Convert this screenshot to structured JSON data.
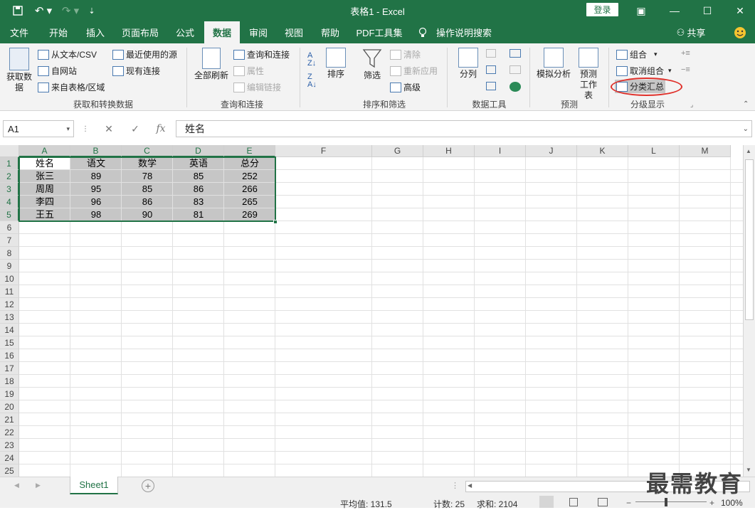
{
  "app": {
    "title": "表格1  -  Excel",
    "login": "登录"
  },
  "menu_tabs": [
    "文件",
    "开始",
    "插入",
    "页面布局",
    "公式",
    "数据",
    "审阅",
    "视图",
    "帮助",
    "PDF工具集",
    "操作说明搜索"
  ],
  "menu_active": "数据",
  "share": "共享",
  "ribbon": {
    "get_data": "获取数据",
    "from_text_csv": "从文本/CSV",
    "from_web": "自网站",
    "from_table": "来自表格/区域",
    "recent_sources": "最近使用的源",
    "existing_connections": "现有连接",
    "group_get_transform": "获取和转换数据",
    "refresh_all": "全部刷新",
    "queries_connections": "查询和连接",
    "properties": "属性",
    "edit_links": "编辑链接",
    "group_queries": "查询和连接",
    "sort": "排序",
    "filter": "筛选",
    "clear": "清除",
    "reapply": "重新应用",
    "advanced": "高级",
    "group_sort_filter": "排序和筛选",
    "text_to_columns": "分列",
    "group_data_tools": "数据工具",
    "what_if": "模拟分析",
    "forecast_sheet": "预测工作表",
    "group_forecast": "预测",
    "group_btn": "组合",
    "ungroup_btn": "取消组合",
    "subtotal_btn": "分类汇总",
    "group_outline": "分级显示"
  },
  "formula_bar": {
    "name_box": "A1",
    "fx": "fx",
    "content": "姓名"
  },
  "columns": [
    "A",
    "B",
    "C",
    "D",
    "E",
    "F",
    "G",
    "H",
    "I",
    "J",
    "K",
    "L",
    "M"
  ],
  "rows": [
    "1",
    "2",
    "3",
    "4",
    "5",
    "6",
    "7",
    "8",
    "9",
    "10",
    "11",
    "12",
    "13",
    "14",
    "15",
    "16",
    "17",
    "18",
    "19",
    "20",
    "21",
    "22",
    "23",
    "24",
    "25"
  ],
  "table": {
    "header": [
      "姓名",
      "语文",
      "数学",
      "英语",
      "总分"
    ],
    "rows": [
      [
        "张三",
        "89",
        "78",
        "85",
        "252"
      ],
      [
        "周周",
        "95",
        "85",
        "86",
        "266"
      ],
      [
        "李四",
        "96",
        "86",
        "83",
        "265"
      ],
      [
        "王五",
        "98",
        "90",
        "81",
        "269"
      ]
    ]
  },
  "sheet_tab": "Sheet1",
  "status": {
    "average": "平均值: 131.5",
    "count": "计数: 25",
    "sum": "求和: 2104",
    "zoom": "100%"
  },
  "watermark": "最需教育",
  "colors": {
    "excel_green": "#217346",
    "ribbon_bg": "#f3f3f3",
    "selection": "#c6c6c6",
    "highlight_circle": "#e0302a"
  }
}
